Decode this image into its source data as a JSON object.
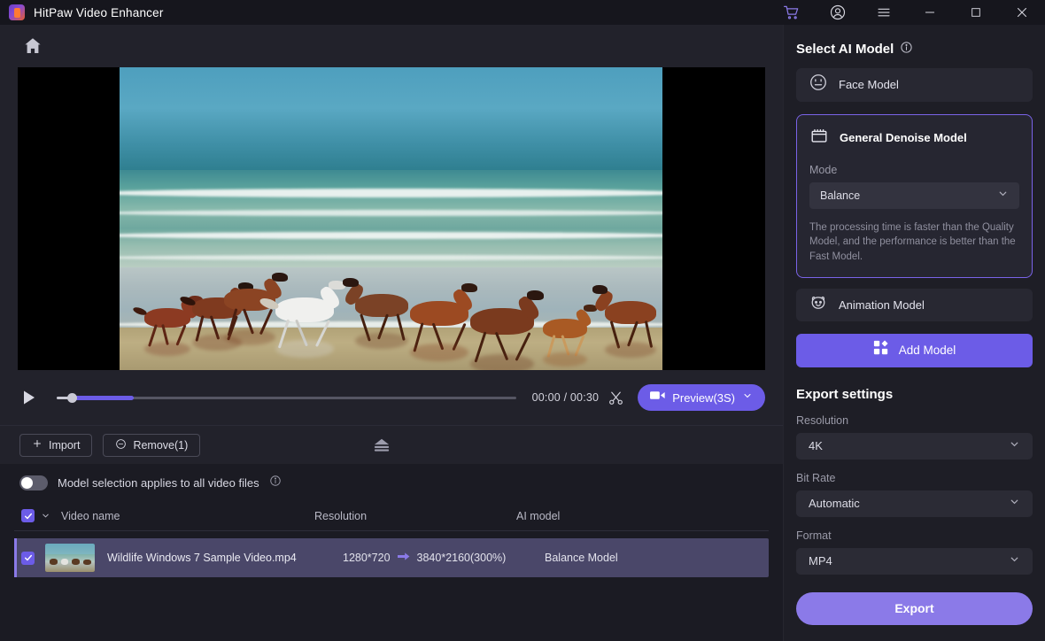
{
  "titlebar": {
    "app_title": "HitPaw Video Enhancer",
    "icons": [
      "cart-icon",
      "account-icon",
      "menu-icon",
      "minimize-icon",
      "maximize-icon",
      "close-icon"
    ]
  },
  "player": {
    "home_icon": "home-icon",
    "play_icon": "play-icon",
    "time": "00:00 / 00:30",
    "cut_icon": "scissors-icon",
    "preview_label": "Preview(3S)",
    "preview_icon": "video-camera-icon"
  },
  "filelist": {
    "import_label": "Import",
    "remove_label": "Remove(1)",
    "eject_icon": "eject-icon",
    "toggle_label": "Model selection applies to all video files",
    "toggle_state": "off",
    "columns": {
      "name": "Video name",
      "resolution": "Resolution",
      "model": "AI model"
    },
    "rows": [
      {
        "checked": true,
        "name": "Wildlife Windows 7 Sample Video.mp4",
        "res_from": "1280*720",
        "res_to": "3840*2160(300%)",
        "model": "Balance Model"
      }
    ]
  },
  "panel": {
    "title": "Select AI Model",
    "info_icon": "info-icon",
    "models": [
      {
        "label": "Face Model",
        "icon": "face-icon",
        "selected": false
      },
      {
        "label": "General Denoise Model",
        "icon": "film-icon",
        "selected": true
      },
      {
        "label": "Animation Model",
        "icon": "bear-face-icon",
        "selected": false
      }
    ],
    "mode_label": "Mode",
    "mode_value": "Balance",
    "model_description": "The processing time is faster than the Quality Model, and the performance is better than the Fast Model.",
    "add_model_label": "Add Model",
    "add_model_icon": "grid-plus-icon"
  },
  "export": {
    "title": "Export settings",
    "resolution_label": "Resolution",
    "resolution_value": "4K",
    "bitrate_label": "Bit Rate",
    "bitrate_value": "Automatic",
    "format_label": "Format",
    "format_value": "MP4",
    "export_label": "Export"
  },
  "colors": {
    "accent": "#6c5ce7",
    "accent_light": "#8b7ae8",
    "bg": "#1b1b23",
    "panel_bg": "#1e1e26"
  }
}
